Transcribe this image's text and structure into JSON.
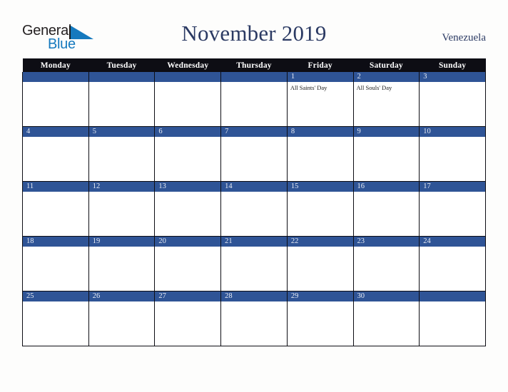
{
  "brand": {
    "word_one": "General",
    "word_two": "Blue",
    "triangle_icon": "blue-triangle-icon",
    "accent_color": "#1579be",
    "text_color": "#231f20"
  },
  "header": {
    "title": "November 2019",
    "country": "Venezuela",
    "title_color": "#2b3a63"
  },
  "calendar": {
    "band_color": "#2f5496",
    "header_bg": "#0d0d14",
    "weekdays": [
      "Monday",
      "Tuesday",
      "Wednesday",
      "Thursday",
      "Friday",
      "Saturday",
      "Sunday"
    ],
    "weeks": [
      [
        {
          "day": "",
          "events": []
        },
        {
          "day": "",
          "events": []
        },
        {
          "day": "",
          "events": []
        },
        {
          "day": "",
          "events": []
        },
        {
          "day": "1",
          "events": [
            "All Saints' Day"
          ]
        },
        {
          "day": "2",
          "events": [
            "All Souls' Day"
          ]
        },
        {
          "day": "3",
          "events": []
        }
      ],
      [
        {
          "day": "4",
          "events": []
        },
        {
          "day": "5",
          "events": []
        },
        {
          "day": "6",
          "events": []
        },
        {
          "day": "7",
          "events": []
        },
        {
          "day": "8",
          "events": []
        },
        {
          "day": "9",
          "events": []
        },
        {
          "day": "10",
          "events": []
        }
      ],
      [
        {
          "day": "11",
          "events": []
        },
        {
          "day": "12",
          "events": []
        },
        {
          "day": "13",
          "events": []
        },
        {
          "day": "14",
          "events": []
        },
        {
          "day": "15",
          "events": []
        },
        {
          "day": "16",
          "events": []
        },
        {
          "day": "17",
          "events": []
        }
      ],
      [
        {
          "day": "18",
          "events": []
        },
        {
          "day": "19",
          "events": []
        },
        {
          "day": "20",
          "events": []
        },
        {
          "day": "21",
          "events": []
        },
        {
          "day": "22",
          "events": []
        },
        {
          "day": "23",
          "events": []
        },
        {
          "day": "24",
          "events": []
        }
      ],
      [
        {
          "day": "25",
          "events": []
        },
        {
          "day": "26",
          "events": []
        },
        {
          "day": "27",
          "events": []
        },
        {
          "day": "28",
          "events": []
        },
        {
          "day": "29",
          "events": []
        },
        {
          "day": "30",
          "events": []
        },
        {
          "day": "",
          "events": []
        }
      ]
    ]
  }
}
